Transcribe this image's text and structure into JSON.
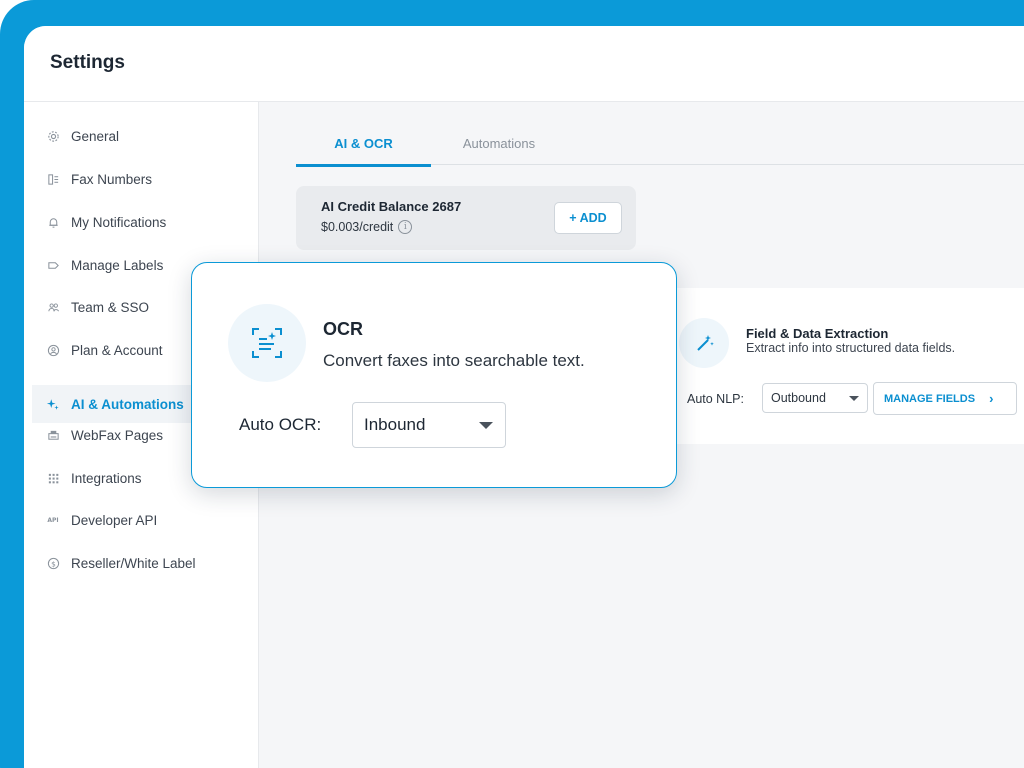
{
  "header": {
    "title": "Settings"
  },
  "sidebar": {
    "items": [
      {
        "label": "General",
        "icon": "gear-icon"
      },
      {
        "label": "Fax Numbers",
        "icon": "fax-numbers-icon"
      },
      {
        "label": "My Notifications",
        "icon": "bell-icon"
      },
      {
        "label": "Manage Labels",
        "icon": "label-icon"
      },
      {
        "label": "Team & SSO",
        "icon": "team-icon"
      },
      {
        "label": "Plan & Account",
        "icon": "account-icon"
      },
      {
        "label": "AI & Automations",
        "icon": "sparkle-icon",
        "active": true
      },
      {
        "label": "WebFax Pages",
        "icon": "webfax-icon"
      },
      {
        "label": "Integrations",
        "icon": "grid-icon"
      },
      {
        "label": "Developer API",
        "icon": "api-icon"
      },
      {
        "label": "Reseller/White Label",
        "icon": "dollar-icon"
      }
    ]
  },
  "tabs": [
    {
      "label": "AI & OCR",
      "active": true
    },
    {
      "label": "Automations",
      "active": false
    }
  ],
  "credit": {
    "title": "AI Credit Balance 2687",
    "rate": "$0.003/credit",
    "add_label": "+ ADD"
  },
  "field_extraction": {
    "title": "Field & Data Extraction",
    "description": "Extract info into structured data fields.",
    "nlp_label": "Auto NLP:",
    "nlp_value": "Outbound",
    "manage_label": "MANAGE FIELDS",
    "manage_chevron": "›"
  },
  "ocr": {
    "title": "OCR",
    "description": "Convert faxes into searchable text.",
    "auto_label": "Auto OCR:",
    "auto_value": "Inbound"
  },
  "colors": {
    "accent": "#0b8fd0",
    "frame_border": "#0b9ad8",
    "content_bg": "#f5f6f8"
  }
}
